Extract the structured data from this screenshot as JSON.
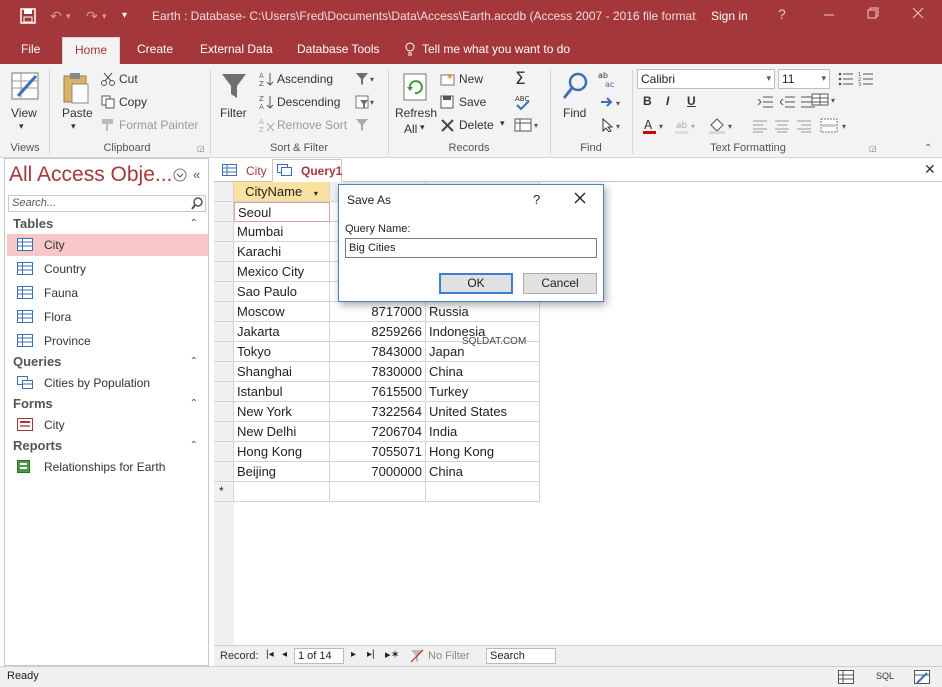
{
  "titlebar": {
    "title": "Earth : Database- C:\\Users\\Fred\\Documents\\Data\\Access\\Earth.accdb (Access 2007 - 2016 file format...",
    "signin": "Sign in",
    "help": "?"
  },
  "ribbon_tabs": [
    "File",
    "Home",
    "Create",
    "External Data",
    "Database Tools"
  ],
  "tell_me": "Tell me what you want to do",
  "ribbon": {
    "views": {
      "view": "View",
      "label": "Views"
    },
    "clipboard": {
      "paste": "Paste",
      "cut": "Cut",
      "copy": "Copy",
      "format_painter": "Format Painter",
      "label": "Clipboard"
    },
    "sort_filter": {
      "filter": "Filter",
      "ascending": "Ascending",
      "descending": "Descending",
      "remove_sort": "Remove Sort",
      "label": "Sort & Filter"
    },
    "records": {
      "refresh": "Refresh",
      "all": "All",
      "new": "New",
      "save": "Save",
      "delete": "Delete",
      "label": "Records"
    },
    "find": {
      "find": "Find",
      "label": "Find"
    },
    "text_formatting": {
      "font": "Calibri",
      "size": "11",
      "bold": "B",
      "italic": "I",
      "underline": "U",
      "label": "Text Formatting"
    }
  },
  "nav": {
    "title": "All Access Obje...",
    "search_placeholder": "Search...",
    "groups": [
      {
        "name": "Tables",
        "items": [
          "City",
          "Country",
          "Fauna",
          "Flora",
          "Province"
        ]
      },
      {
        "name": "Queries",
        "items": [
          "Cities by Population"
        ]
      },
      {
        "name": "Forms",
        "items": [
          "City"
        ]
      },
      {
        "name": "Reports",
        "items": [
          "Relationships for Earth"
        ]
      }
    ]
  },
  "doc_tabs": [
    "City",
    "Query1"
  ],
  "datasheet": {
    "header": "CityName",
    "rows": [
      [
        "Seoul",
        "",
        ""
      ],
      [
        "Mumbai",
        "",
        ""
      ],
      [
        "Karachi",
        "",
        ""
      ],
      [
        "Mexico City",
        "",
        ""
      ],
      [
        "Sao Paulo",
        "",
        ""
      ],
      [
        "Moscow",
        "8717000",
        "Russia"
      ],
      [
        "Jakarta",
        "8259266",
        "Indonesia"
      ],
      [
        "Tokyo",
        "7843000",
        "Japan"
      ],
      [
        "Shanghai",
        "7830000",
        "China"
      ],
      [
        "Istanbul",
        "7615500",
        "Turkey"
      ],
      [
        "New York",
        "7322564",
        "United States"
      ],
      [
        "New Delhi",
        "7206704",
        "India"
      ],
      [
        "Hong Kong",
        "7055071",
        "Hong Kong"
      ],
      [
        "Beijing",
        "7000000",
        "China"
      ]
    ],
    "new_row_marker": "*"
  },
  "watermark": "SQLDAT.COM",
  "dialog": {
    "title": "Save As",
    "help": "?",
    "label": "Query Name:",
    "value": "Big Cities",
    "ok": "OK",
    "cancel": "Cancel"
  },
  "record_nav": {
    "label": "Record:",
    "position": "1 of 14",
    "filter": "No Filter",
    "search": "Search"
  },
  "status": {
    "text": "Ready",
    "sql": "SQL"
  },
  "colors": {
    "accent": "#a4373a",
    "selected_row": "#f8c7c8",
    "header_cell": "#f9e19f"
  }
}
